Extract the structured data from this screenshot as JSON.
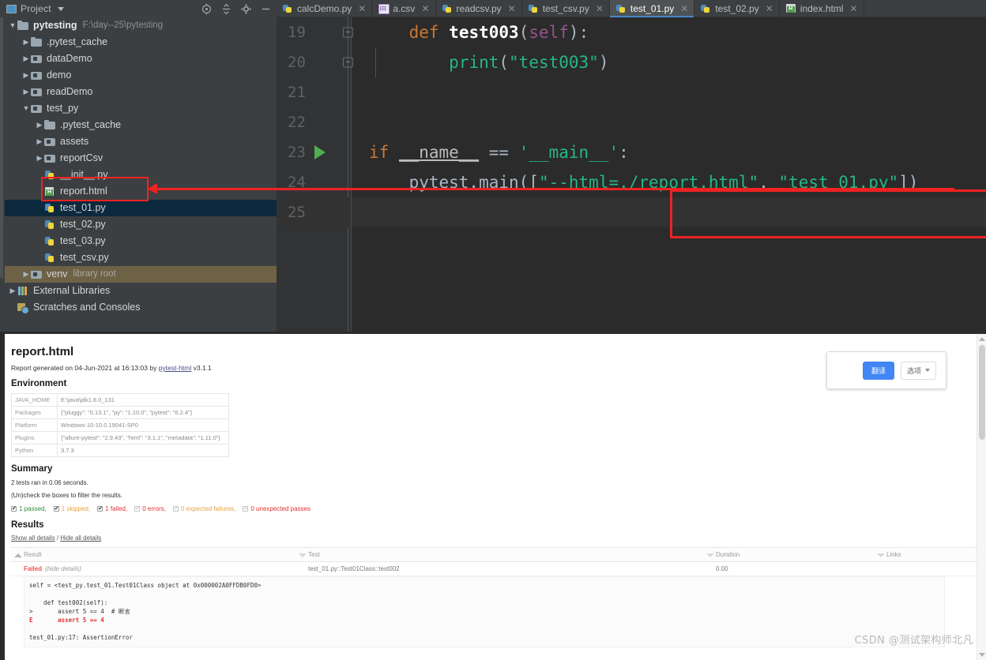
{
  "ide": {
    "project_panel": {
      "title": "Project",
      "toolbar_icons": [
        "target-icon",
        "collapse-all-icon",
        "settings-gear-icon",
        "minimize-icon"
      ],
      "tree": [
        {
          "depth": 0,
          "arrow": "down",
          "icon": "folder-icon",
          "label": "pytesting",
          "path": "F:\\day--25\\pytesting",
          "state": "normal"
        },
        {
          "depth": 1,
          "arrow": "right",
          "icon": "folder-icon",
          "label": ".pytest_cache",
          "path": "",
          "state": "normal"
        },
        {
          "depth": 1,
          "arrow": "right",
          "icon": "module-folder-icon",
          "label": "dataDemo",
          "path": "",
          "state": "normal"
        },
        {
          "depth": 1,
          "arrow": "right",
          "icon": "module-folder-icon",
          "label": "demo",
          "path": "",
          "state": "normal"
        },
        {
          "depth": 1,
          "arrow": "right",
          "icon": "module-folder-icon",
          "label": "readDemo",
          "path": "",
          "state": "normal"
        },
        {
          "depth": 1,
          "arrow": "down",
          "icon": "module-folder-icon",
          "label": "test_py",
          "path": "",
          "state": "normal"
        },
        {
          "depth": 2,
          "arrow": "right",
          "icon": "folder-icon",
          "label": ".pytest_cache",
          "path": "",
          "state": "normal"
        },
        {
          "depth": 2,
          "arrow": "right",
          "icon": "module-folder-icon",
          "label": "assets",
          "path": "",
          "state": "normal"
        },
        {
          "depth": 2,
          "arrow": "right",
          "icon": "module-folder-icon",
          "label": "reportCsv",
          "path": "",
          "state": "normal"
        },
        {
          "depth": 2,
          "arrow": "none",
          "icon": "python-file-icon",
          "label": "__init__.py",
          "path": "",
          "state": "normal"
        },
        {
          "depth": 2,
          "arrow": "none",
          "icon": "html-file-icon",
          "label": "report.html",
          "path": "",
          "state": "highlighted"
        },
        {
          "depth": 2,
          "arrow": "none",
          "icon": "python-file-icon",
          "label": "test_01.py",
          "path": "",
          "state": "selected"
        },
        {
          "depth": 2,
          "arrow": "none",
          "icon": "python-file-icon",
          "label": "test_02.py",
          "path": "",
          "state": "normal"
        },
        {
          "depth": 2,
          "arrow": "none",
          "icon": "python-file-icon",
          "label": "test_03.py",
          "path": "",
          "state": "normal"
        },
        {
          "depth": 2,
          "arrow": "none",
          "icon": "python-file-icon",
          "label": "test_csv.py",
          "path": "",
          "state": "normal"
        },
        {
          "depth": 1,
          "arrow": "right",
          "icon": "module-folder-icon",
          "label": "venv",
          "path": "library root",
          "state": "venv"
        },
        {
          "depth": 0,
          "arrow": "right",
          "icon": "external-libs-icon",
          "label": "External Libraries",
          "path": "",
          "state": "normal"
        },
        {
          "depth": 0,
          "arrow": "none",
          "icon": "scratches-icon",
          "label": "Scratches and Consoles",
          "path": "",
          "state": "normal"
        }
      ]
    },
    "tabs": [
      {
        "label": "calcDemo.py",
        "icon": "python-file-icon",
        "active": false
      },
      {
        "label": "a.csv",
        "icon": "csv-file-icon",
        "active": false
      },
      {
        "label": "readcsv.py",
        "icon": "python-file-icon",
        "active": false
      },
      {
        "label": "test_csv.py",
        "icon": "python-file-icon",
        "active": false
      },
      {
        "label": "test_01.py",
        "icon": "python-file-icon",
        "active": true
      },
      {
        "label": "test_02.py",
        "icon": "python-file-icon",
        "active": false
      },
      {
        "label": "index.html",
        "icon": "html-file-icon",
        "active": false
      }
    ],
    "editor": {
      "line_numbers": [
        "19",
        "20",
        "21",
        "22",
        "23",
        "24",
        "25"
      ],
      "lines": [
        {
          "num": "19",
          "tokens": [
            {
              "t": "    ",
              "c": "pun"
            },
            {
              "t": "def",
              "c": "kw"
            },
            {
              "t": " ",
              "c": "pun"
            },
            {
              "t": "test003",
              "c": "fnb"
            },
            {
              "t": "(",
              "c": "pun"
            },
            {
              "t": "self",
              "c": "self"
            },
            {
              "t": "):",
              "c": "pun"
            }
          ]
        },
        {
          "num": "20",
          "tokens": [
            {
              "t": "        ",
              "c": "pun"
            },
            {
              "t": "print",
              "c": "strg"
            },
            {
              "t": "(",
              "c": "pun"
            },
            {
              "t": "\"test003\"",
              "c": "strg"
            },
            {
              "t": ")",
              "c": "pun"
            }
          ]
        },
        {
          "num": "21",
          "tokens": []
        },
        {
          "num": "22",
          "tokens": []
        },
        {
          "num": "23",
          "tokens": [
            {
              "t": "",
              "c": "pun"
            },
            {
              "t": "if",
              "c": "kw"
            },
            {
              "t": " ",
              "c": "pun"
            },
            {
              "t": "__name__",
              "c": "dunder"
            },
            {
              "t": " == ",
              "c": "pun"
            },
            {
              "t": "'__main__'",
              "c": "strg"
            },
            {
              "t": ":",
              "c": "pun"
            }
          ]
        },
        {
          "num": "24",
          "tokens": [
            {
              "t": "    ",
              "c": "pun"
            },
            {
              "t": "pytest.main",
              "c": "mcall"
            },
            {
              "t": "([",
              "c": "pun"
            },
            {
              "t": "\"--html=./report.html\"",
              "c": "strg"
            },
            {
              "t": ", ",
              "c": "pun"
            },
            {
              "t": "\"test_01.py\"",
              "c": "strg"
            },
            {
              "t": "])",
              "c": "pun"
            }
          ]
        },
        {
          "num": "25",
          "tokens": []
        }
      ]
    }
  },
  "report": {
    "title": "report.html",
    "generated_prefix": "Report generated on ",
    "generated_date": "04-Jun-2021",
    "generated_at": " at ",
    "generated_time": "16:13:03",
    "generated_by": " by ",
    "generator_link": "pytest-html",
    "generator_version": " v3.1.1",
    "environment_heading": "Environment",
    "environment": [
      {
        "key": "JAVA_HOME",
        "value": "E:\\java\\jdk1.8.0_131"
      },
      {
        "key": "Packages",
        "value": "{\"pluggy\": \"0.13.1\", \"py\": \"1.10.0\", \"pytest\": \"6.2.4\"}"
      },
      {
        "key": "Platform",
        "value": "Windows-10-10.0.19041-SP0"
      },
      {
        "key": "Plugins",
        "value": "{\"allure-pytest\": \"2.9.43\", \"html\": \"3.1.1\", \"metadata\": \"1.11.0\"}"
      },
      {
        "key": "Python",
        "value": "3.7.3"
      }
    ],
    "summary_heading": "Summary",
    "summary_line1": "2 tests ran in 0.06 seconds.",
    "summary_line2": "(Un)check the boxes to filter the results.",
    "filters": [
      {
        "label": "1 passed,",
        "checked": true,
        "color": "c-pass"
      },
      {
        "label": "1 skipped,",
        "checked": true,
        "color": "c-skip"
      },
      {
        "label": "1 failed,",
        "checked": true,
        "color": "c-fail"
      },
      {
        "label": "0 errors,",
        "checked": false,
        "color": "c-err"
      },
      {
        "label": "0 expected failures,",
        "checked": false,
        "color": "c-xfail"
      },
      {
        "label": "0 unexpected passes",
        "checked": false,
        "color": "c-xpass"
      }
    ],
    "results_heading": "Results",
    "show_all": "Show all details",
    "details_sep": " / ",
    "hide_all": "Hide all details",
    "columns": [
      "Result",
      "Test",
      "Duration",
      "Links"
    ],
    "rows": [
      {
        "result": "Failed",
        "result_note": "(hide details)",
        "test": "test_01.py::Test01Class::test002",
        "duration": "0.00",
        "links": ""
      }
    ],
    "error_detail": "self = <test_py.test_01.Test01Class object at 0x000002A0FFDB0FD0>\n\n    def test002(self):\n>       assert 5 == 4  # 断言\nE       assert 5 == 4\n\ntest_01.py:17: AssertionError",
    "translate_popup": {
      "translate_label": "翻译",
      "options_label": "选项"
    },
    "watermark": "CSDN @测试架构师北凡"
  },
  "annotations": {
    "highlight_color": "#ee2222"
  }
}
